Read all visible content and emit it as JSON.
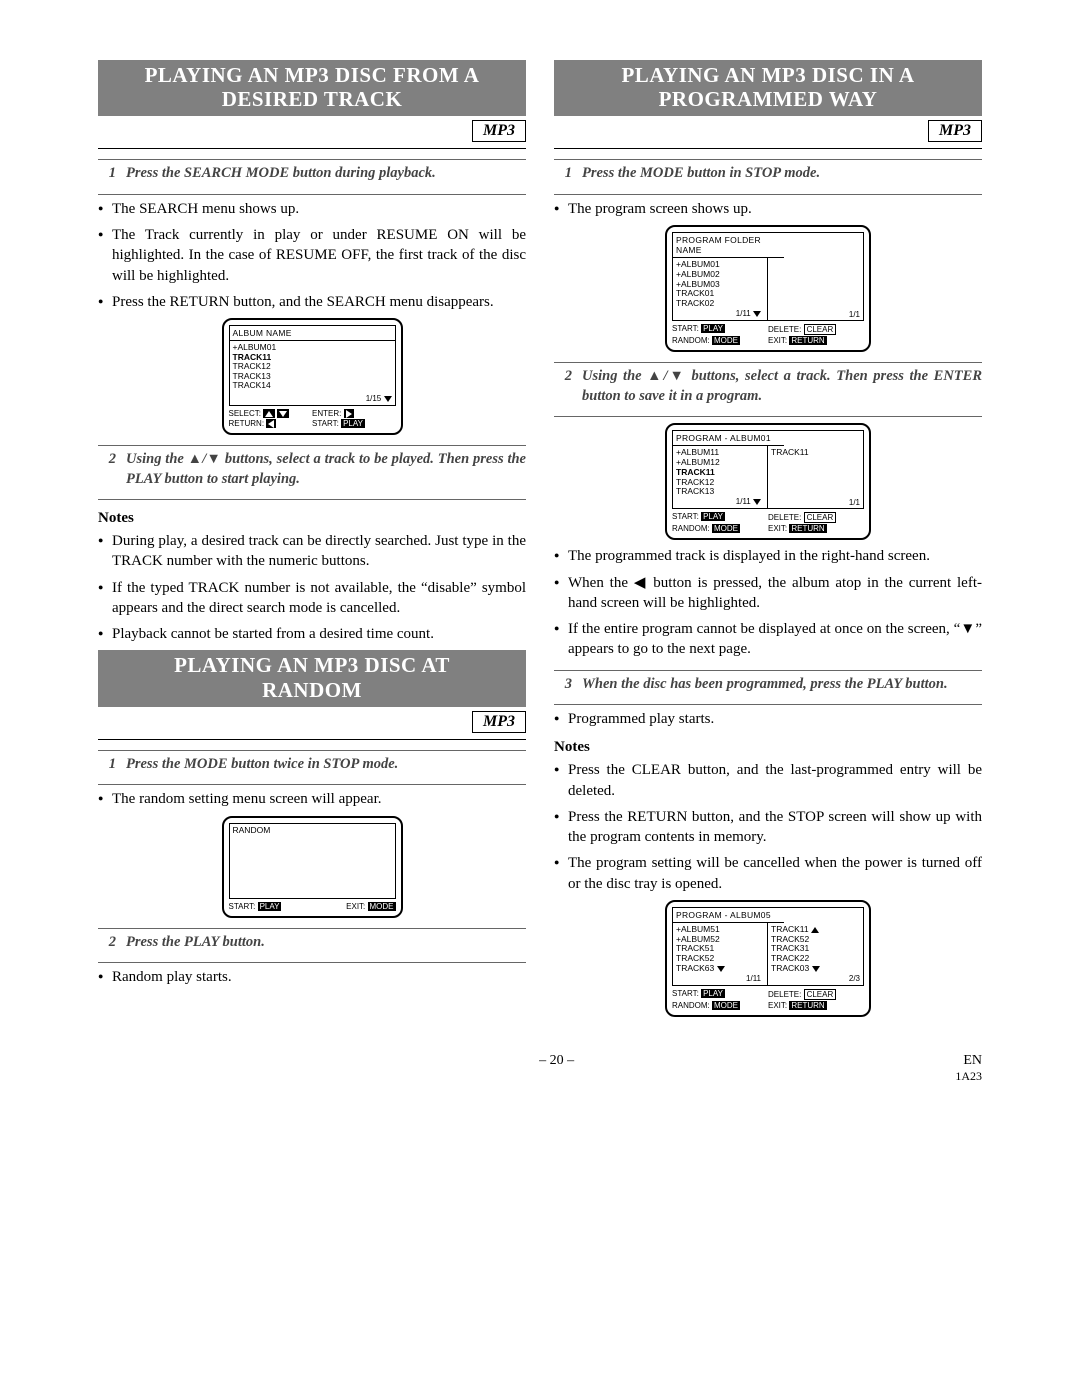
{
  "page": {
    "number_label": "– 20 –",
    "lang": "EN",
    "code": "1A23"
  },
  "mp3_label": "MP3",
  "icons": {
    "up": "▲",
    "down": "▼",
    "left": "◀",
    "right": "▶"
  },
  "sections": {
    "desired_track": {
      "title_l1": "PLAYING AN MP3 DISC FROM A",
      "title_l2": "DESIRED TRACK",
      "step1": {
        "num": "1",
        "text": "Press the SEARCH MODE button during playback."
      },
      "bullets_after1": [
        "The SEARCH menu shows up.",
        "The Track currently in play or under RESUME ON will be highlighted. In the case of RESUME OFF, the first track of the disc will be highlighted.",
        "Press the RETURN button, and the SEARCH menu disappears."
      ],
      "osd1": {
        "title": "ALBUM NAME",
        "items": [
          "+ALBUM01",
          "TRACK11",
          "TRACK12",
          "TRACK13",
          "TRACK14"
        ],
        "highlighted_index": 1,
        "page": "1/15",
        "footer_l1_a": "SELECT:",
        "footer_l1_b": "ENTER:",
        "footer_l2_a": "RETURN:",
        "footer_l2_b": "START:",
        "lbl_play": "PLAY"
      },
      "step2": {
        "num": "2",
        "text": "Using the ▲/▼ buttons, select a track to be played. Then press the PLAY button to start playing."
      },
      "notes_head": "Notes",
      "notes": [
        "During play, a desired track can be directly searched. Just type in the TRACK number with the numeric buttons.",
        "If the typed TRACK number is not available, the “disable” symbol appears and the direct search mode is cancelled.",
        "Playback cannot be started from a desired time count."
      ]
    },
    "random": {
      "title_l1": "PLAYING AN MP3 DISC AT",
      "title_l2": "RANDOM",
      "step1": {
        "num": "1",
        "text": "Press the MODE button twice in STOP mode."
      },
      "bullets_after1": [
        "The random setting menu screen will appear."
      ],
      "osd1": {
        "title": "RANDOM",
        "footer_a": "START:",
        "footer_b": "EXIT:",
        "lbl_play": "PLAY",
        "lbl_mode": "MODE"
      },
      "step2": {
        "num": "2",
        "text": "Press the PLAY button."
      },
      "bullets_after2": [
        "Random play starts."
      ]
    },
    "programmed": {
      "title_l1": "PLAYING AN MP3 DISC IN A",
      "title_l2": "PROGRAMMED WAY",
      "step1": {
        "num": "1",
        "text": "Press the MODE button in STOP mode."
      },
      "bullets_after1": [
        "The program screen shows up."
      ],
      "osd1": {
        "title": "PROGRAM FOLDER NAME",
        "left_items": [
          "+ALBUM01",
          "+ALBUM02",
          "+ALBUM03",
          "TRACK01",
          "TRACK02"
        ],
        "left_page": "1/11",
        "right_page": "1/1",
        "footer": {
          "start": "START:",
          "play": "PLAY",
          "delete": "DELETE:",
          "clear": "CLEAR",
          "random": "RANDOM:",
          "mode": "MODE",
          "exit": "EXIT:",
          "return": "RETURN"
        }
      },
      "step2": {
        "num": "2",
        "text": "Using the ▲/▼ buttons, select a track. Then press the ENTER button to save it in a program."
      },
      "osd2": {
        "title": "PROGRAM - ALBUM01",
        "left_items": [
          "+ALBUM11",
          "+ALBUM12",
          "TRACK11",
          "TRACK12",
          "TRACK13"
        ],
        "left_highlight_index": 2,
        "left_page": "1/11",
        "right_items": [
          "TRACK11"
        ],
        "right_page": "1/1",
        "footer": {
          "start": "START:",
          "play": "PLAY",
          "delete": "DELETE:",
          "clear": "CLEAR",
          "random": "RANDOM:",
          "mode": "MODE",
          "exit": "EXIT:",
          "return": "RETURN"
        }
      },
      "bullets_after2": [
        "The programmed track is displayed in the right-hand screen.",
        "When the ◀ button is pressed, the album atop in the current left-hand screen will be highlighted.",
        "If the entire program cannot be displayed at once on the screen, “▼” appears to go to the next page."
      ],
      "step3": {
        "num": "3",
        "text": "When the disc has been programmed, press the PLAY button."
      },
      "bullets_after3": [
        "Programmed play starts."
      ],
      "notes_head": "Notes",
      "notes": [
        "Press the CLEAR button, and the last-programmed entry will be deleted.",
        "Press the RETURN button, and the STOP screen will show up with the program contents in memory.",
        "The program setting will be cancelled when the power is turned off or the disc tray is opened."
      ],
      "osd3": {
        "title": "PROGRAM - ALBUM05",
        "left_items": [
          "+ALBUM51",
          "+ALBUM52",
          "TRACK51",
          "TRACK52",
          "TRACK63"
        ],
        "left_page": "1/11",
        "right_items": [
          "TRACK11",
          "TRACK52",
          "TRACK31",
          "TRACK22",
          "TRACK03"
        ],
        "right_page": "2/3",
        "footer": {
          "start": "START:",
          "play": "PLAY",
          "delete": "DELETE:",
          "clear": "CLEAR",
          "random": "RANDOM:",
          "mode": "MODE",
          "exit": "EXIT:",
          "return": "RETURN"
        }
      }
    }
  }
}
